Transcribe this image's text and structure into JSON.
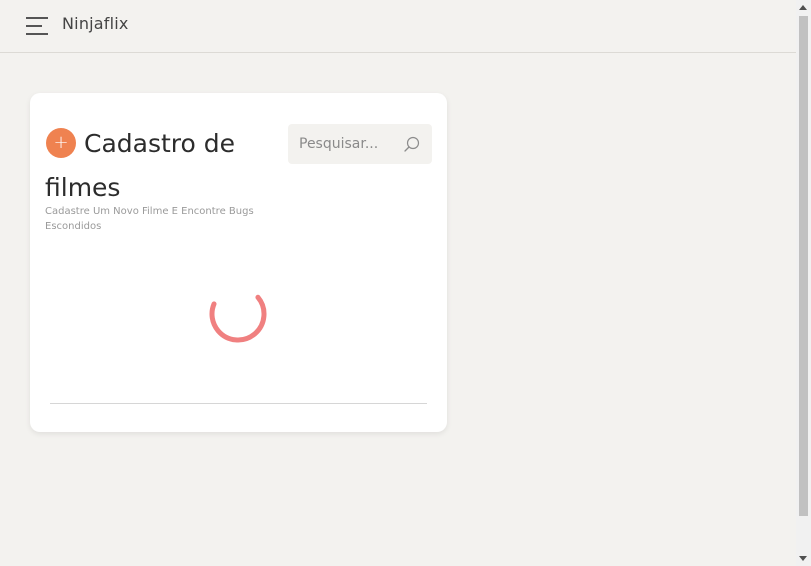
{
  "header": {
    "brand": "Ninjaflix"
  },
  "card": {
    "title": "Cadastro de filmes",
    "subtitle": "Cadastre Um Novo Filme E Encontre Bugs Escondidos",
    "add_icon": "+",
    "search": {
      "placeholder": "Pesquisar...",
      "value": ""
    },
    "loading": true
  },
  "icons": {
    "menu": "hamburger-icon",
    "add": "plus-icon",
    "search": "magnifier-icon",
    "loading": "spinner-icon"
  },
  "colors": {
    "background": "#f3f2ef",
    "accent": "#ef8250",
    "spinner": "#f08080",
    "card": "#ffffff"
  }
}
